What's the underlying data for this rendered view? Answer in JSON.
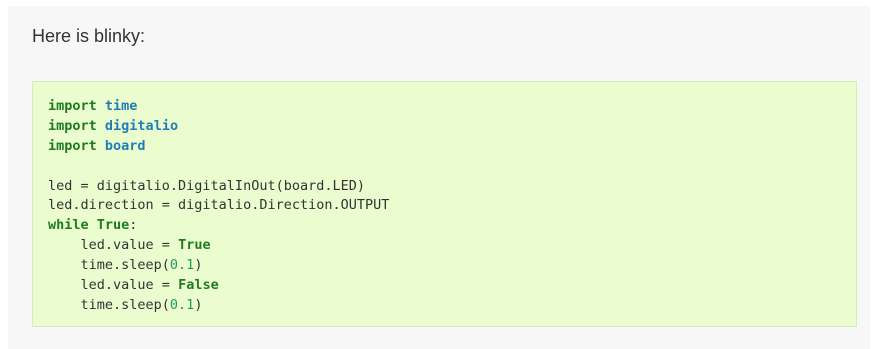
{
  "intro_text": "Here is blinky:",
  "code": {
    "lines": [
      {
        "kw": "import",
        "sp": " ",
        "mod": "time"
      },
      {
        "kw": "import",
        "sp": " ",
        "mod": "digitalio"
      },
      {
        "kw": "import",
        "sp": " ",
        "mod": "board"
      },
      {
        "blank": ""
      },
      {
        "text": "led = digitalio.DigitalInOut(board.LED)"
      },
      {
        "text": "led.direction = digitalio.Direction.OUTPUT"
      },
      {
        "kw1": "while",
        "sp": " ",
        "kw2": "True",
        "colon": ":"
      },
      {
        "indent": "    ",
        "text": "led.value = ",
        "const": "True"
      },
      {
        "indent": "    ",
        "text": "time.sleep(",
        "num": "0.1",
        "close": ")"
      },
      {
        "indent": "    ",
        "text": "led.value = ",
        "const": "False"
      },
      {
        "indent": "    ",
        "text": "time.sleep(",
        "num": "0.1",
        "close": ")"
      }
    ]
  },
  "colors": {
    "code_background": "#ebfdcf",
    "keyword": "#1e7b22",
    "module": "#1f7fb3",
    "number": "#1f9c5a"
  }
}
